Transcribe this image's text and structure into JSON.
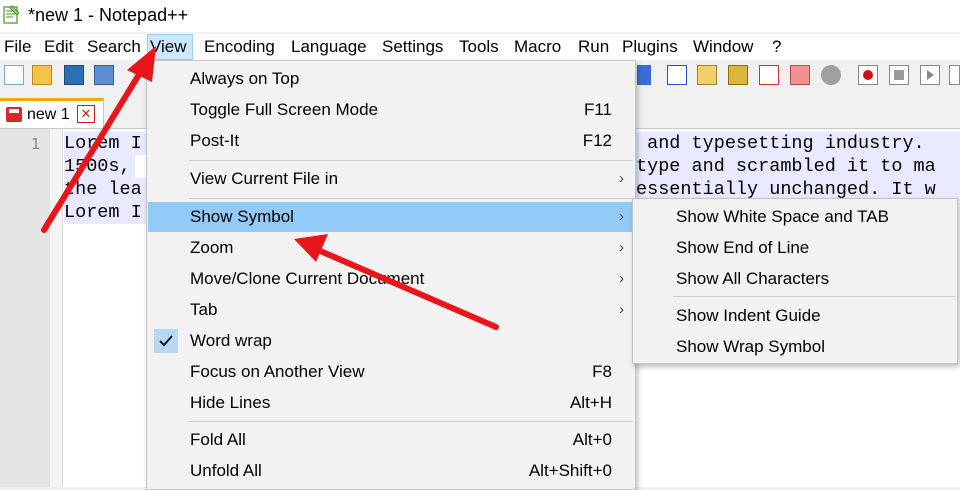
{
  "window": {
    "title": "*new 1 - Notepad++"
  },
  "menubar": {
    "items": [
      {
        "label": "File"
      },
      {
        "label": "Edit"
      },
      {
        "label": "Search"
      },
      {
        "label": "View"
      },
      {
        "label": "Encoding"
      },
      {
        "label": "Language"
      },
      {
        "label": "Settings"
      },
      {
        "label": "Tools"
      },
      {
        "label": "Macro"
      },
      {
        "label": "Run"
      },
      {
        "label": "Plugins"
      },
      {
        "label": "Window"
      },
      {
        "label": "?"
      }
    ]
  },
  "tabs": [
    {
      "label": "new 1",
      "close_symbol": "✕"
    }
  ],
  "editor": {
    "line_number": "1",
    "lines": [
      "Lorem I",
      "1500s,",
      "the lea",
      "Lorem I"
    ],
    "right_fragments": [
      " and typesetting industry.",
      "type and scrambled it to ma",
      "essentially unchanged. It w"
    ]
  },
  "view_menu": {
    "items": [
      {
        "label": "Always on Top",
        "shortcut": ""
      },
      {
        "label": "Toggle Full Screen Mode",
        "shortcut": "F11"
      },
      {
        "label": "Post-It",
        "shortcut": "F12"
      },
      {
        "label": "View Current File in",
        "shortcut": "",
        "arrow": "›"
      },
      {
        "label": "Show Symbol",
        "shortcut": "",
        "arrow": "›"
      },
      {
        "label": "Zoom",
        "shortcut": "",
        "arrow": "›"
      },
      {
        "label": "Move/Clone Current Document",
        "shortcut": "",
        "arrow": "›"
      },
      {
        "label": "Tab",
        "shortcut": "",
        "arrow": "›"
      },
      {
        "label": "Word wrap",
        "shortcut": "",
        "checked": true
      },
      {
        "label": "Focus on Another View",
        "shortcut": "F8"
      },
      {
        "label": "Hide Lines",
        "shortcut": "Alt+H"
      },
      {
        "label": "Fold All",
        "shortcut": "Alt+0"
      },
      {
        "label": "Unfold All",
        "shortcut": "Alt+Shift+0"
      }
    ]
  },
  "show_symbol_submenu": {
    "items": [
      {
        "label": "Show White Space and TAB"
      },
      {
        "label": "Show End of Line"
      },
      {
        "label": "Show All Characters"
      },
      {
        "label": "Show Indent Guide"
      },
      {
        "label": "Show Wrap Symbol"
      }
    ]
  },
  "colors": {
    "highlight": "#91c9f7",
    "annotation_arrow": "#e8161b",
    "tab_accent": "#f5a700"
  }
}
